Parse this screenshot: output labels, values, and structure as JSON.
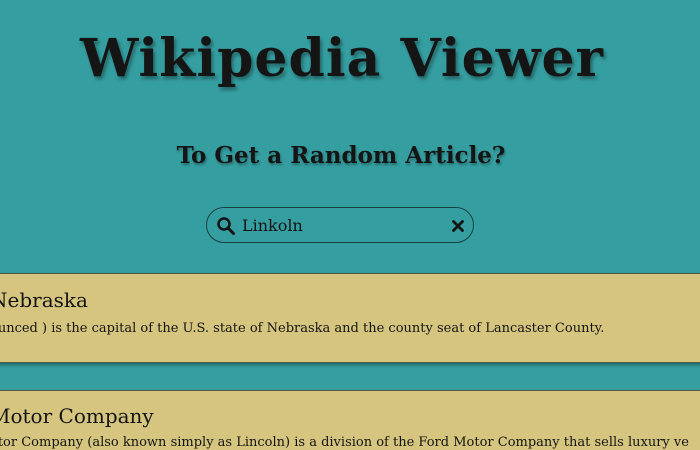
{
  "header": {
    "title": "Wikipedia Viewer",
    "subtitle": "To Get a Random Article?"
  },
  "search": {
    "value": "Linkoln",
    "icon": "search-icon",
    "clear_icon": "close-icon"
  },
  "results": [
    {
      "title": "Nebraska",
      "snippet": "ounced ) is the capital of the U.S. state of Nebraska and the county seat of Lancaster County."
    },
    {
      "title": "Motor Company",
      "snippet": "otor Company (also known simply as Lincoln) is a division of the Ford Motor Company that sells luxury ve"
    }
  ],
  "colors": {
    "background": "#359ea0",
    "card": "#d6c57f",
    "text": "#141414"
  }
}
